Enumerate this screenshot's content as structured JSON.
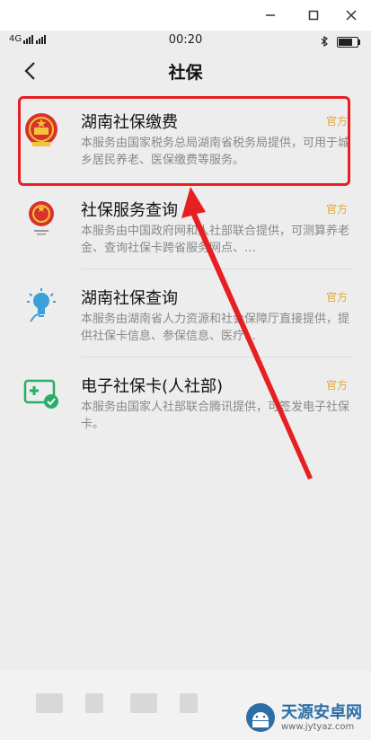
{
  "status": {
    "signal": "4G",
    "time": "00:20"
  },
  "header": {
    "title": "社保"
  },
  "items": [
    {
      "name": "湖南社保缴费",
      "tag": "官方",
      "desc": "本服务由国家税务总局湖南省税务局提供，可用于城乡居民养老、医保缴费等服务。"
    },
    {
      "name": "社保服务查询",
      "tag": "官方",
      "desc": "本服务由中国政府网和人社部联合提供，可测算养老金、查询社保卡跨省服务网点、…"
    },
    {
      "name": "湖南社保查询",
      "tag": "官方",
      "desc": "本服务由湖南省人力资源和社会保障厅直接提供，提供社保卡信息、参保信息、医疗…"
    },
    {
      "name": "电子社保卡(人社部)",
      "tag": "官方",
      "desc": "本服务由国家人社部联合腾讯提供，可签发电子社保卡。"
    }
  ],
  "watermark": {
    "name": "天源安卓网",
    "url": "www.jytyaz.com"
  },
  "colors": {
    "official_tag": "#e3a53a",
    "highlight": "#e62022",
    "icon_green": "#2aae67",
    "icon_blue": "#39a0d8"
  }
}
